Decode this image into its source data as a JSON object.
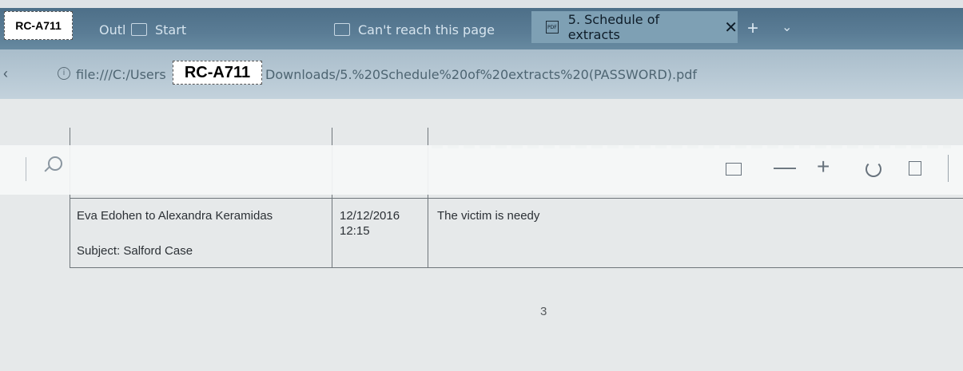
{
  "badge": {
    "text": "RC-A711"
  },
  "tabs": {
    "tab_outlook": "Outl",
    "tab_start": "Start",
    "tab_cant_reach": "Can't reach this page",
    "active_tab": "5. Schedule of extracts",
    "active_tab_icon": "PDF",
    "close": "✕",
    "new_tab": "+",
    "menu": "⌄"
  },
  "address_bar": {
    "url_prefix": "file:///C:/Users",
    "url_suffix": "Downloads/5.%20Schedule%20of%20extracts%20(PASSWORD).pdf"
  },
  "pdf_toolbar": {
    "zoom_out": "—",
    "zoom_in": "+"
  },
  "document": {
    "row": {
      "from_to": "Eva Edohen to Alexandra Keramidas",
      "subject": "Subject: Salford Case",
      "date": "12/12/2016",
      "time": "12:15",
      "extract": "The victim is needy"
    },
    "page_number": "3"
  },
  "colors": {
    "tabbar": "#5a7c95",
    "active_tab": "#7ea0b4",
    "address_bar": "#b9cad6",
    "page_bg": "#e6e9ea"
  }
}
